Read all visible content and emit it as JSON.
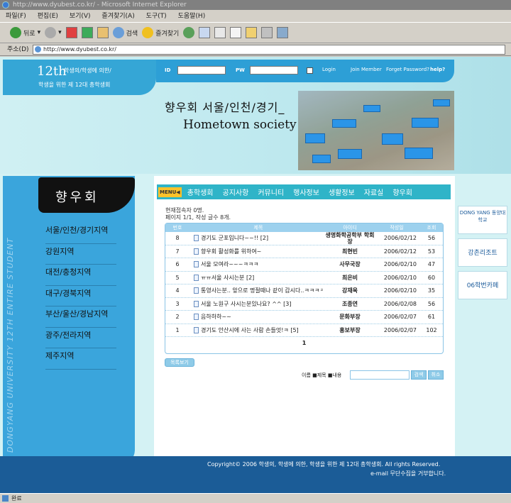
{
  "browser": {
    "title": "http://www.dyubest.co.kr/ - Microsoft Internet Explorer",
    "menu": [
      "파일(F)",
      "편집(E)",
      "보기(V)",
      "즐겨찾기(A)",
      "도구(T)",
      "도움말(H)"
    ],
    "back": "뒤로",
    "search": "검색",
    "favorites": "즐겨찾기",
    "address_label": "주소(D)",
    "address": "http://www.dyubest.co.kr/",
    "status": "완료"
  },
  "logo": {
    "num": "12th",
    "line1": "학생의/학생에 의한/",
    "line2": "학생을 위한 제 12대 총학생회"
  },
  "login": {
    "id_label": "ID",
    "pw_label": "PW",
    "login": "Login",
    "join": "Join Member",
    "forgot": "Forget Password?",
    "help": "help?"
  },
  "heading": {
    "kor": "향우회 서울/인천/경기_",
    "eng": "Hometown society"
  },
  "sidebar": {
    "brush": "향우회",
    "vertical": "DONGYANG UNIVERSITY 12TH ENTIRE STUDENT",
    "items": [
      "서울/인천/경기지역",
      "강원지역",
      "대전/충청지역",
      "대구/경북지역",
      "부산/울산/경남지역",
      "광주/전라지역",
      "제주지역"
    ]
  },
  "nav": {
    "menu": "MENU◀",
    "items": [
      "총학생회",
      "공지사항",
      "커뮤니티",
      "행사정보",
      "생활정보",
      "자료실",
      "향우회"
    ]
  },
  "count": {
    "line1": "현재접속자 0명.",
    "line2": "페이지 1/1, 작성 글수 8개."
  },
  "board": {
    "headers": [
      "번호",
      "제목",
      "아이디",
      "작성일",
      "조회"
    ],
    "rows": [
      {
        "no": "8",
        "title": "경기도 군포입니다~~!! [2]",
        "author": "생명화학공학부 학회장",
        "date": "2006/02/12",
        "views": "56"
      },
      {
        "no": "7",
        "title": "향우회 활성화를 위하여~",
        "author": "최현빈",
        "date": "2006/02/12",
        "views": "53"
      },
      {
        "no": "6",
        "title": "서울 모여라~~~ㅋㅋㅋ",
        "author": "사무국장",
        "date": "2006/02/10",
        "views": "47"
      },
      {
        "no": "5",
        "title": "ㅠㅠ서울 사시는분 [2]",
        "author": "최은비",
        "date": "2006/02/10",
        "views": "60"
      },
      {
        "no": "4",
        "title": "통영사는분.. 앞으로 명절때나 같이 갑시다..ㅋㅋㅋㅋ [2]",
        "author": "강재욱",
        "date": "2006/02/10",
        "views": "35"
      },
      {
        "no": "3",
        "title": "서울 노원구 사시는분있나요? ^^ [3]",
        "author": "조종연",
        "date": "2006/02/08",
        "views": "56"
      },
      {
        "no": "2",
        "title": "음하하하~~",
        "author": "문화부장",
        "date": "2006/02/07",
        "views": "61"
      },
      {
        "no": "1",
        "title": "경기도 안산시에 사는 사람 손들엇!ㅋ [5]",
        "author": "홍보부장",
        "date": "2006/02/07",
        "views": "102"
      }
    ],
    "page": "1",
    "list_button": "목록보기"
  },
  "searchbox": {
    "options": "이름 ■제목 ■내용",
    "btn1": "검색",
    "btn2": "취소"
  },
  "banners": [
    "DONG YANG 동양대학교",
    "강촌리조트",
    "06학번카페"
  ],
  "footer": {
    "line1": "Copyright© 2006 학생의, 학생에 의한, 학생을 위한 제 12대 총학생회. All rights Reserved.",
    "line2": "e-mail 무단수집을 거부합니다."
  }
}
